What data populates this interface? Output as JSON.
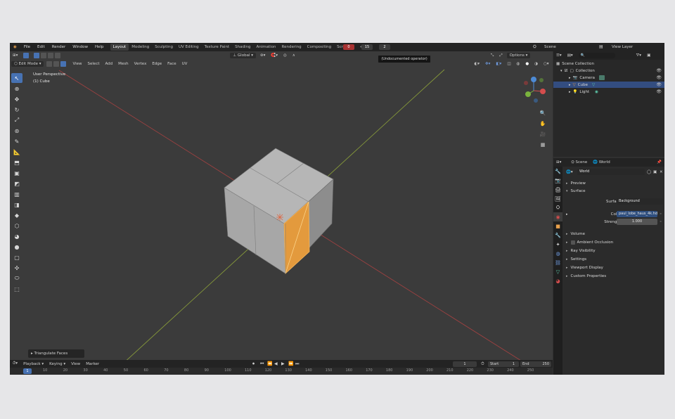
{
  "menu": [
    "File",
    "Edit",
    "Render",
    "Window",
    "Help"
  ],
  "workspaces": [
    "Layout",
    "Modeling",
    "Sculpting",
    "UV Editing",
    "Texture Paint",
    "Shading",
    "Animation",
    "Rendering",
    "Compositing",
    "Scripting"
  ],
  "add_ws": "+",
  "rec_values": [
    "0",
    "15",
    "2"
  ],
  "tooltip": "(Undocumented operator)",
  "scene": {
    "scene_label": "Scene",
    "view_layer": "View Layer"
  },
  "viewport": {
    "mode": "Edit Mode",
    "menus": [
      "View",
      "Select",
      "Add",
      "Mesh",
      "Vertex",
      "Edge",
      "Face",
      "UV"
    ],
    "orientation": "Global",
    "options": "Options",
    "view_name": "User Perspective",
    "object": "(1) Cube",
    "operator": "Triangulate Faces"
  },
  "timeline": {
    "menus": [
      "Playback",
      "Keying",
      "View",
      "Marker"
    ],
    "current_frame": "1",
    "start_label": "Start",
    "start": "1",
    "end_label": "End",
    "end": "250",
    "frame_indicator": "1",
    "ticks": [
      "10",
      "20",
      "30",
      "40",
      "50",
      "60",
      "70",
      "80",
      "90",
      "100",
      "110",
      "120",
      "130",
      "140",
      "150",
      "160",
      "170",
      "180",
      "190",
      "200",
      "210",
      "220",
      "230",
      "240",
      "250"
    ]
  },
  "outliner": {
    "scene_collection": "Scene Collection",
    "collection": "Collection",
    "items": [
      "Camera",
      "Cube",
      "Light"
    ]
  },
  "properties": {
    "scene_tab": "Scene",
    "world_tab": "World",
    "world_name": "World",
    "panels": {
      "preview": "Preview",
      "surface": "Surface",
      "volume": "Volume",
      "ambient_occlusion": "Ambient Occlusion",
      "ray_visibility": "Ray Visibility",
      "settings": "Settings",
      "viewport_display": "Viewport Display",
      "custom_properties": "Custom Properties"
    },
    "surface_label": "Surface",
    "surface_value": "Background",
    "color_label": "Color",
    "color_value": "paul_lobe_haus_4k.hdr",
    "strength_label": "Strength",
    "strength_value": "1.000"
  },
  "colors": {
    "accent": "#4772b3",
    "selection": "#e89b3c",
    "x_axis": "#a84545",
    "y_axis": "#8aa034"
  }
}
